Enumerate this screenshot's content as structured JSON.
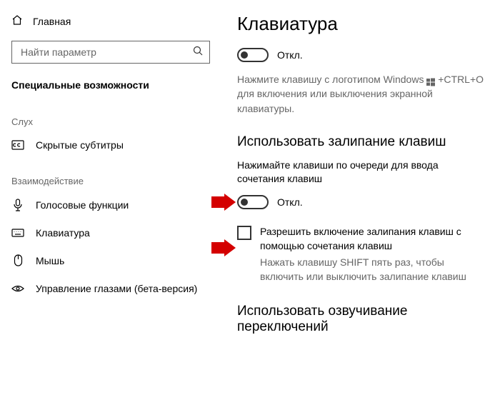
{
  "sidebar": {
    "home": "Главная",
    "search_placeholder": "Найти параметр",
    "section": "Специальные возможности",
    "group1": "Слух",
    "item_cc": "Скрытые субтитры",
    "group2": "Взаимодействие",
    "item_voice": "Голосовые функции",
    "item_keyboard": "Клавиатура",
    "item_mouse": "Мышь",
    "item_eye": "Управление глазами (бета-версия)"
  },
  "main": {
    "title": "Клавиатура",
    "toggle1_label": "Откл.",
    "desc1a": "Нажмите клавишу с логотипом Windows",
    "desc1b": "+CTRL+O для включения или выключения экранной клавиатуры.",
    "h2_sticky": "Использовать залипание клавиш",
    "sticky_sub": "Нажимайте клавиши по очереди для ввода сочетания клавиш",
    "toggle2_label": "Откл.",
    "check_label": "Разрешить включение залипания клавиш с помощью сочетания клавиш",
    "check_hint": "Нажать клавишу SHIFT пять раз, чтобы включить или выключить залипание клавиш",
    "h2_sound": "Использовать озвучивание переключений"
  }
}
